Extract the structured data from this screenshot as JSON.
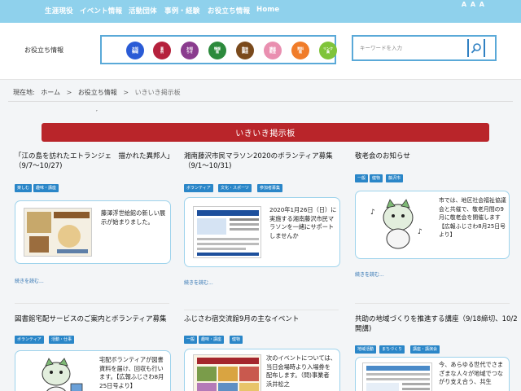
{
  "nav": {
    "items": [
      "生涯現役",
      "イベント情報",
      "活動団体",
      "事例・経験",
      "お役立ち情報",
      "Home"
    ],
    "font_size_control": "A A A"
  },
  "header": {
    "section_label": "お役立ち情報",
    "categories": [
      {
        "label": "お知\n情報",
        "color": "#2a5bd6"
      },
      {
        "label": "事\n例",
        "color": "#b5213c"
      },
      {
        "label": "お知\nらせ",
        "color": "#8a3c8e"
      },
      {
        "label": "情報\n館",
        "color": "#2c8a3c"
      },
      {
        "label": "趣味\n講座",
        "color": "#7a4a1c"
      },
      {
        "label": "講座\n教室",
        "color": "#e98fb0"
      },
      {
        "label": "資料\n館",
        "color": "#f07c29"
      },
      {
        "label": "リンク\n集",
        "color": "#7fc43a"
      }
    ],
    "search_placeholder": "キーワードを入力"
  },
  "breadcrumb": {
    "prefix": "現在地:",
    "items": [
      "ホーム",
      "お役立ち情報",
      "いきいき掲示板"
    ],
    "separator": ">"
  },
  "tick_mark": "′",
  "banner_title": "いきいき掲示板",
  "cards": [
    {
      "title": "「江の島を訪れたエトランジェ　描かれた異邦人」（9/7〜10/27)",
      "tags": [
        "楽しむ",
        "趣味・講座"
      ],
      "excerpt": "藤澤浮世絵館の新しい展示が始まりました。",
      "readmore": "続きを読む..."
    },
    {
      "title": "湘南藤沢市民マラソン2020のボランティア募集（9/1〜10/31)",
      "tags": [
        "ボランティア",
        "文化・スポーツ",
        "参加者募集"
      ],
      "excerpt": "2020年1月26日（日）に実施する湘南藤沢市民マラソンを一緒にサポートしませんか",
      "readmore": "続きを読む..."
    },
    {
      "title": "敬老会のお知らせ",
      "tags": [
        "一般",
        "健物",
        "藤沢市"
      ],
      "excerpt": "市では、地区社会福祉協議会と共催で、敬老月間の9月に敬老会を開催します【広報ふじさわ8月25日号より】",
      "readmore": "続きを読む..."
    },
    {
      "title": "図書館宅配サービスのご案内とボランティア募集",
      "tags": [
        "ボランティア",
        "活動・仕事"
      ],
      "excerpt": "宅配ボランティアが図書資料を届け、回収も行います。【広報ふじさわ8月25日号より】",
      "readmore": ""
    },
    {
      "title": "ふじさわ宿交流館9月の主なイベント",
      "tags": [
        "一般",
        "趣味・講座",
        "健物"
      ],
      "excerpt": "次のイベントについては、当日会場時より入場券を配布します。（問)事業者　浜井松之",
      "readmore": ""
    },
    {
      "title": "共助の地域づくりを推進する講座（9/18締切、10/2開講)",
      "tags": [
        "地域活動",
        "まちづくり",
        "講座・講演会"
      ],
      "excerpt": "今、あらゆる世代でさまざまな人々が地域でつながり支え合う、共生",
      "readmore": ""
    }
  ]
}
